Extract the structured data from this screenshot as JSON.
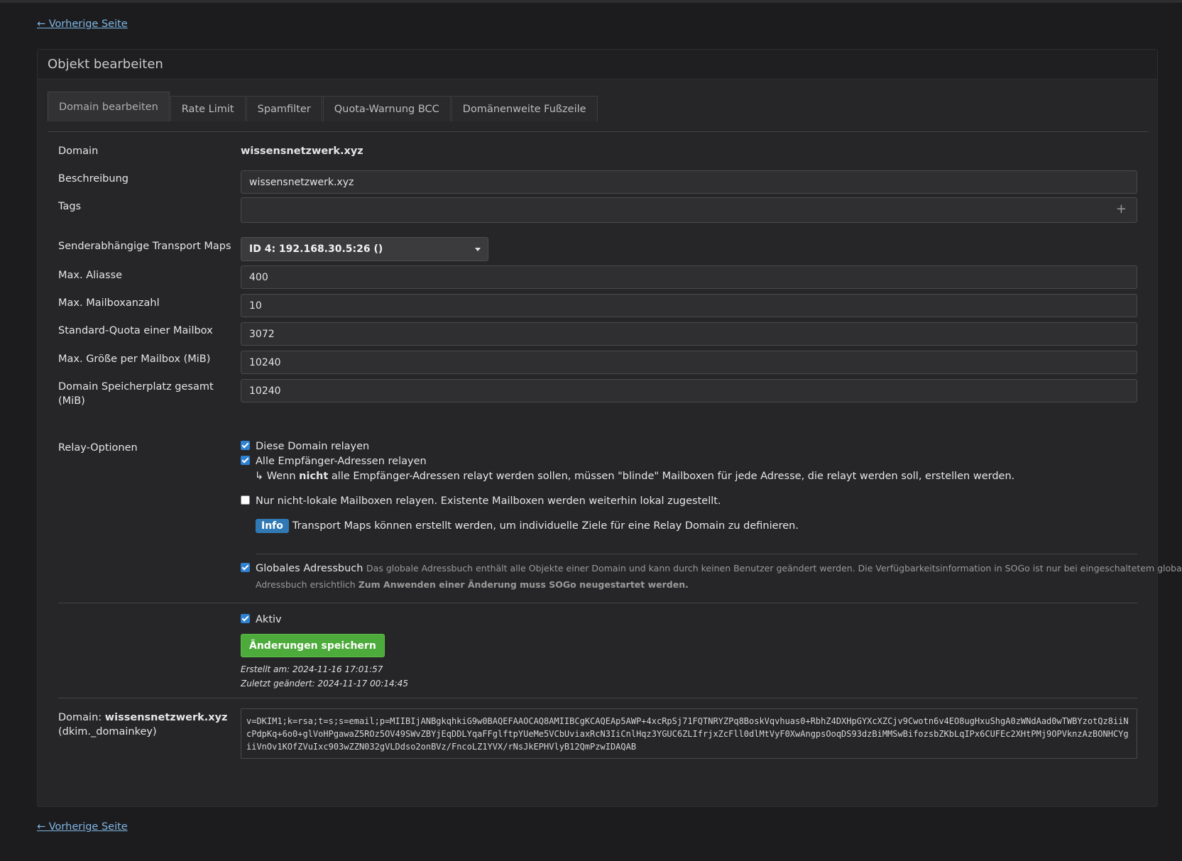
{
  "nav": {
    "back_label": "← Vorherige Seite"
  },
  "panel": {
    "title": "Objekt bearbeiten"
  },
  "tabs": [
    {
      "label": "Domain bearbeiten",
      "active": true
    },
    {
      "label": "Rate Limit"
    },
    {
      "label": "Spamfilter"
    },
    {
      "label": "Quota-Warnung BCC"
    },
    {
      "label": "Domänenweite Fußzeile"
    }
  ],
  "form": {
    "domain": {
      "label": "Domain",
      "value": "wissensnetzwerk.xyz"
    },
    "description": {
      "label": "Beschreibung",
      "value": "wissensnetzwerk.xyz"
    },
    "tags": {
      "label": "Tags",
      "value": "",
      "add_icon": "plus-icon"
    },
    "transport_maps": {
      "label": "Senderabhängige Transport Maps",
      "selected": "ID 4: 192.168.30.5:26 ()"
    },
    "max_aliases": {
      "label": "Max. Aliasse",
      "value": "400"
    },
    "max_mailboxes": {
      "label": "Max. Mailboxanzahl",
      "value": "10"
    },
    "default_quota": {
      "label": "Standard-Quota einer Mailbox",
      "value": "3072"
    },
    "max_size_per_mailbox": {
      "label": "Max. Größe per Mailbox (MiB)",
      "value": "10240"
    },
    "domain_storage": {
      "label": "Domain Speicherplatz gesamt (MiB)",
      "value": "10240"
    },
    "relay": {
      "label": "Relay-Optionen",
      "relay_domain": {
        "label": "Diese Domain relayen",
        "checked": true
      },
      "relay_all": {
        "label": "Alle Empfänger-Adressen relayen",
        "checked": true
      },
      "relay_all_hint_prefix": "↳ Wenn ",
      "relay_all_hint_bold": "nicht",
      "relay_all_hint_suffix": " alle Empfänger-Adressen relayt werden sollen, müssen \"blinde\" Mailboxen für jede Adresse, die relayt werden soll, erstellen werden.",
      "relay_unknown_only": {
        "label": "Nur nicht-lokale Mailboxen relayen. Existente Mailboxen werden weiterhin lokal zugestellt.",
        "checked": false
      },
      "info_badge": "Info",
      "info_text": "Transport Maps können erstellt werden, um individuelle Ziele für eine Relay Domain zu definieren."
    },
    "gal": {
      "label": "Globales Adressbuch",
      "checked": true,
      "help_1": "Das globale Adressbuch enthält alle Objekte einer Domain und kann durch keinen Benutzer geändert werden. Die Verfügbarkeitsinformation in SOGo ist nur bei eingeschaltetem globalen",
      "help_2": "Adressbuch ersichtlich ",
      "help_bold": "Zum Anwenden einer Änderung muss SOGo neugestartet werden."
    },
    "active": {
      "label": "Aktiv",
      "checked": true
    },
    "save_label": "Änderungen speichern",
    "created": "Erstellt am: 2024-11-16 17:01:57",
    "modified": "Zuletzt geändert: 2024-11-17 00:14:45"
  },
  "dkim": {
    "label_prefix": "Domain: ",
    "label_domain": "wissensnetzwerk.xyz",
    "label_selector": "(dkim._domainkey)",
    "record": "v=DKIM1;k=rsa;t=s;s=email;p=MIIBIjANBgkqhkiG9w0BAQEFAAOCAQ8AMIIBCgKCAQEAp5AWP+4xcRpSj71FQTNRYZPq8BoskVqvhuas0+RbhZ4DXHpGYXcXZCjv9Cwotn6v4EO8ugHxuShgA0zWNdAad0wTWBYzotQz8iiNcPdpKq+6o0+glVoHPgawaZ5ROz5OV49SWvZBYjEqDDLYqaFFglftpYUeMe5VCbUviaxRcN3IiCnlHqz3YGUC6ZLIfrjxZcFll0dlMtVyF0XwAngpsOoqDS93dzBiMMSwBifozsbZKbLqIPx6CUFEc2XHtPMj9OPVknzAzBONHCYgiiVnOv1KOfZVuIxc903wZZN032gVLDdso2onBVz/FncoLZ1YVX/rNsJkEPHVlyB12QmPzwIDAQAB"
  }
}
